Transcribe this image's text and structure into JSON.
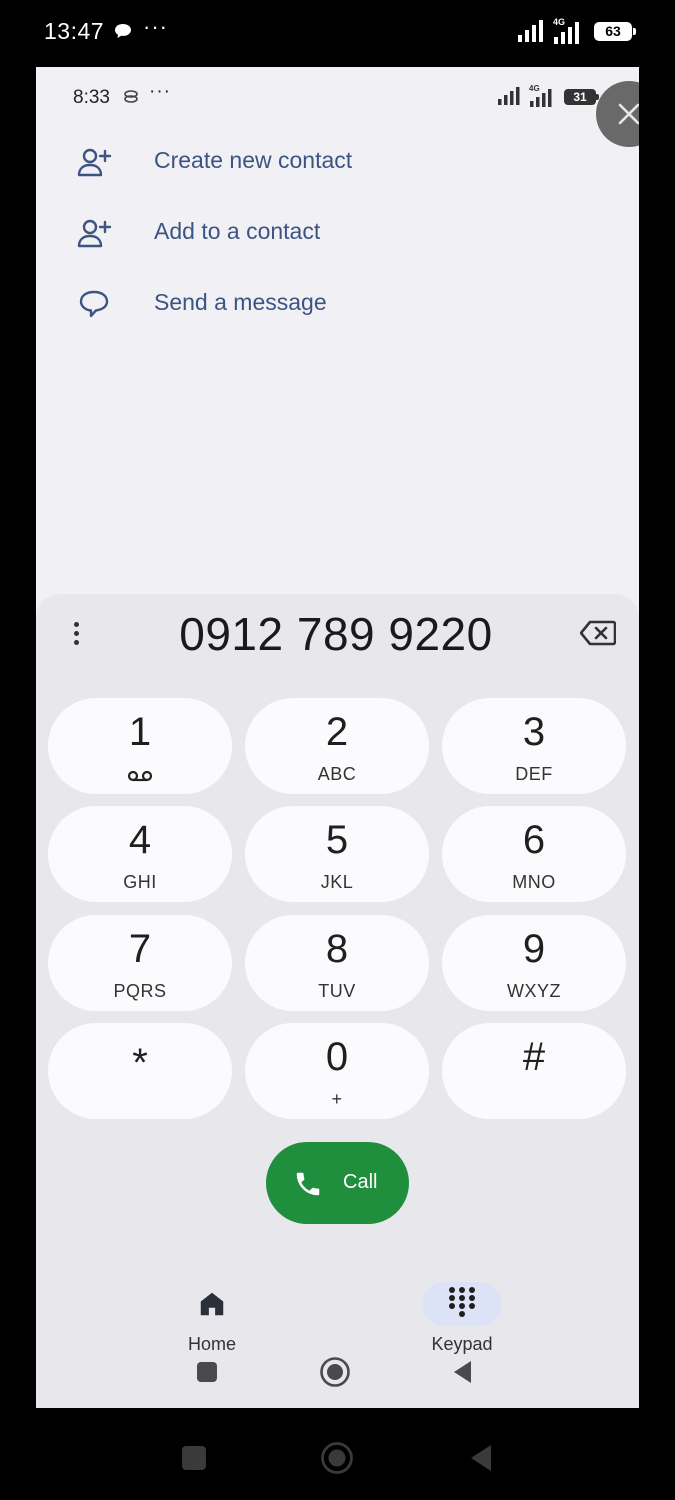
{
  "outer_status": {
    "time": "13:47",
    "dots": "···",
    "network": "4G",
    "battery": "63"
  },
  "inner_status": {
    "time": "8:33",
    "dots": "···",
    "network": "4G",
    "battery": "31"
  },
  "actions": [
    {
      "label": "Create new contact",
      "icon": "person-add-icon"
    },
    {
      "label": "Add to a contact",
      "icon": "person-add-icon"
    },
    {
      "label": "Send a message",
      "icon": "message-icon"
    }
  ],
  "dialer": {
    "number": "0912 789 9220",
    "keys": [
      {
        "digit": "1",
        "letters": ""
      },
      {
        "digit": "2",
        "letters": "ABC"
      },
      {
        "digit": "3",
        "letters": "DEF"
      },
      {
        "digit": "4",
        "letters": "GHI"
      },
      {
        "digit": "5",
        "letters": "JKL"
      },
      {
        "digit": "6",
        "letters": "MNO"
      },
      {
        "digit": "7",
        "letters": "PQRS"
      },
      {
        "digit": "8",
        "letters": "TUV"
      },
      {
        "digit": "9",
        "letters": "WXYZ"
      },
      {
        "digit": "*",
        "letters": ""
      },
      {
        "digit": "0",
        "letters": "+"
      },
      {
        "digit": "#",
        "letters": ""
      }
    ],
    "call_label": "Call"
  },
  "bottom_nav": [
    {
      "label": "Home",
      "icon": "home-icon",
      "active": false
    },
    {
      "label": "Keypad",
      "icon": "keypad-icon",
      "active": true
    }
  ],
  "colors": {
    "accent_text": "#3d5482",
    "call_green": "#1f8e3d",
    "active_nav_pill": "#dde3f6"
  }
}
